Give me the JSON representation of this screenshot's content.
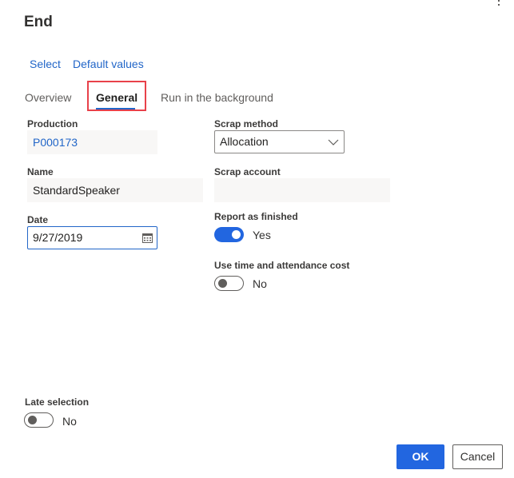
{
  "dialog": {
    "title": "End",
    "more_icon": "more-vertical-icon"
  },
  "actions": [
    {
      "label": "Select"
    },
    {
      "label": "Default values"
    }
  ],
  "tabs": [
    {
      "label": "Overview",
      "active": false
    },
    {
      "label": "General",
      "active": true,
      "highlighted": true
    },
    {
      "label": "Run in the background",
      "active": false
    }
  ],
  "fields": {
    "production": {
      "label": "Production",
      "value": "P000173"
    },
    "name": {
      "label": "Name",
      "value": "StandardSpeaker"
    },
    "date": {
      "label": "Date",
      "value": "9/27/2019",
      "icon": "calendar-icon"
    },
    "scrap_method": {
      "label": "Scrap method",
      "value": "Allocation",
      "icon": "chevron-down-icon"
    },
    "scrap_account": {
      "label": "Scrap account",
      "value": ""
    },
    "report_as_finished": {
      "label": "Report as finished",
      "state": true,
      "text": "Yes"
    },
    "use_time_attendance_cost": {
      "label": "Use time and attendance cost",
      "state": false,
      "text": "No"
    },
    "late_selection": {
      "label": "Late selection",
      "state": false,
      "text": "No"
    }
  },
  "buttons": {
    "ok": "OK",
    "cancel": "Cancel"
  },
  "colors": {
    "accent": "#2266e0",
    "link": "#2266c8",
    "highlight_border": "#e8414a",
    "readonly_bg": "#f8f7f6"
  }
}
